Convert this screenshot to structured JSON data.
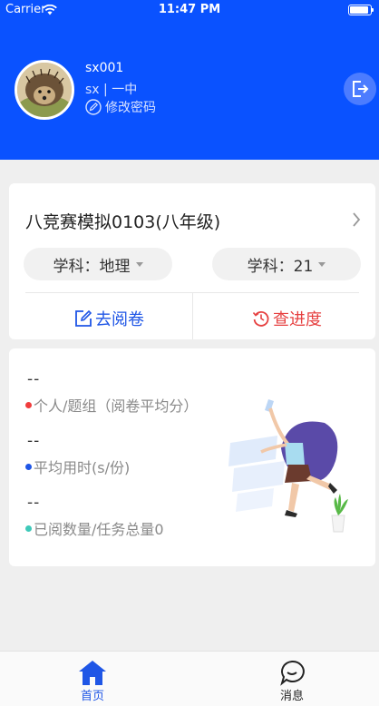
{
  "status_bar": {
    "carrier": "Carrier",
    "time": "11:47 PM"
  },
  "user": {
    "name": "sx001",
    "sub": "sx  |  一中",
    "edit_password": "修改密码"
  },
  "exam": {
    "title": "八竞赛模拟0103(八年级)",
    "subject_filter": "学科：地理",
    "number_filter": "学科：21",
    "grade_button": "去阅卷",
    "progress_button": "查进度"
  },
  "stats": [
    {
      "value": "--",
      "label": "个人/题组（阅卷平均分）",
      "dot_color": "#f03c3c"
    },
    {
      "value": "--",
      "label": "平均用时(s/份)",
      "dot_color": "#1f56e6"
    },
    {
      "value": "--",
      "label": "已阅数量/任务总量0",
      "dot_color": "#3ec9b9"
    }
  ],
  "tabbar": {
    "home": "首页",
    "messages": "消息"
  },
  "colors": {
    "primary": "#0a52ff",
    "danger": "#e64040"
  }
}
